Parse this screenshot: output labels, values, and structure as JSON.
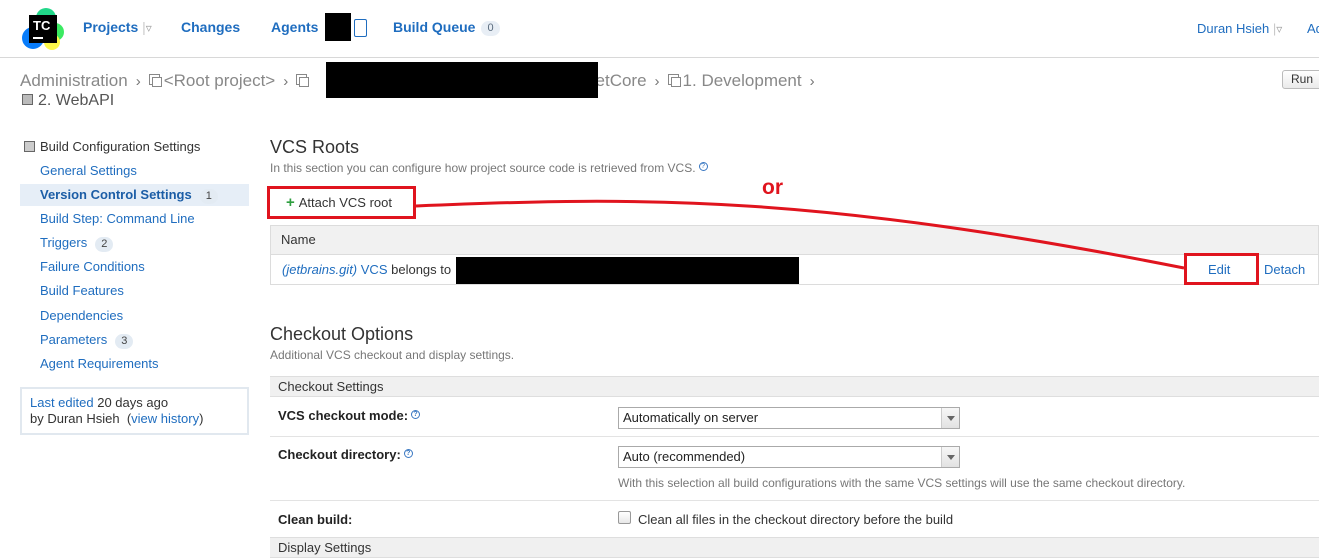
{
  "topbar": {
    "logo_text": "TC",
    "nav": {
      "projects": "Projects",
      "changes": "Changes",
      "agents": "Agents",
      "build_queue": "Build Queue",
      "build_queue_count": "0"
    },
    "user": "Duran Hsieh",
    "admin_partial": "Ad"
  },
  "breadcrumb": {
    "administration": "Administration",
    "root_project": "<Root project>",
    "project_suffix": "NetCore",
    "development": "1. Development",
    "webapi": "2. WebAPI"
  },
  "run_button": "Run",
  "sidebar": {
    "title": "Build Configuration Settings",
    "items": [
      {
        "label": "General Settings",
        "badge": ""
      },
      {
        "label": "Version Control Settings",
        "badge": "1"
      },
      {
        "label": "Build Step: Command Line",
        "badge": ""
      },
      {
        "label": "Triggers",
        "badge": "2"
      },
      {
        "label": "Failure Conditions",
        "badge": ""
      },
      {
        "label": "Build Features",
        "badge": ""
      },
      {
        "label": "Dependencies",
        "badge": ""
      },
      {
        "label": "Parameters",
        "badge": "3"
      },
      {
        "label": "Agent Requirements",
        "badge": ""
      }
    ],
    "last_edited": {
      "link": "Last edited",
      "ago": "20 days ago",
      "by": "by Duran Hsieh",
      "history": "view history"
    }
  },
  "vcs_roots": {
    "title": "VCS Roots",
    "description": "In this section you can configure how project source code is retrieved from VCS.",
    "attach_label": "Attach VCS root",
    "column_name": "Name",
    "row": {
      "italic": "(jetbrains.git)",
      "vcs": "VCS",
      "belongs": "belongs to"
    },
    "edit_label": "Edit",
    "detach_label": "Detach"
  },
  "annotation": {
    "or_text": "or",
    "color": "#e0141e"
  },
  "checkout_options": {
    "title": "Checkout Options",
    "description": "Additional VCS checkout and display settings.",
    "section_checkout": "Checkout Settings",
    "mode_label": "VCS checkout mode:",
    "mode_value": "Automatically on server",
    "dir_label": "Checkout directory:",
    "dir_value": "Auto (recommended)",
    "dir_note": "With this selection all build configurations with the same VCS settings will use the same checkout directory.",
    "clean_label": "Clean build:",
    "clean_checkbox_label": "Clean all files in the checkout directory before the build",
    "section_display": "Display Settings"
  }
}
